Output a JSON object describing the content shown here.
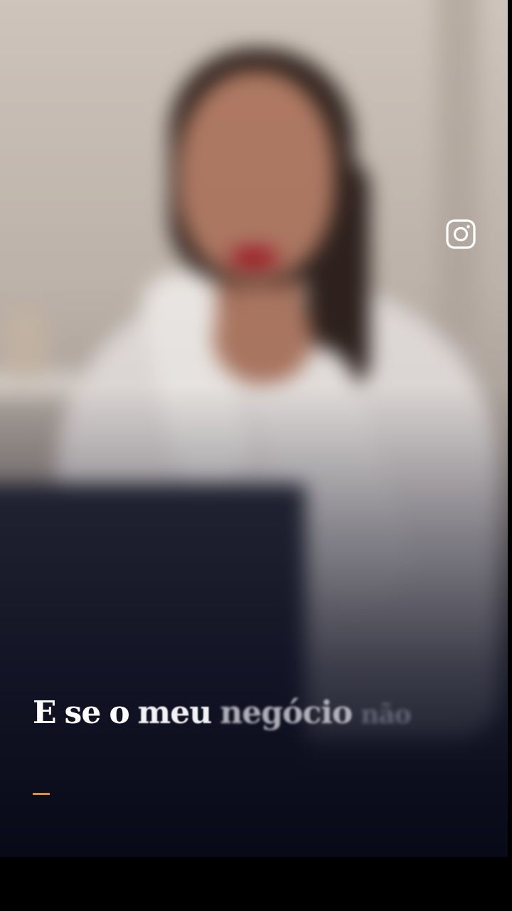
{
  "story": {
    "caption_words": [
      "E",
      "se",
      "o",
      "meu",
      "negócio",
      "não"
    ],
    "accent_color": "#e0902f",
    "instagram_icon": "instagram-icon"
  }
}
